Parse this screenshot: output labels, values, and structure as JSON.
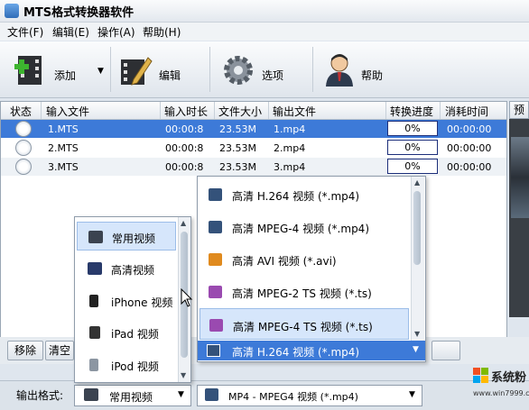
{
  "window": {
    "title": "MTS格式转换器软件"
  },
  "menu": {
    "file": "文件(F)",
    "edit": "编辑(E)",
    "action": "操作(A)",
    "help": "帮助(H)"
  },
  "toolbar": {
    "add": "添加",
    "edit": "编辑",
    "options": "选项",
    "help": "帮助"
  },
  "table": {
    "columns": [
      "状态",
      "输入文件",
      "输入时长",
      "文件大小",
      "输出文件",
      "转换进度",
      "消耗时间"
    ],
    "rows": [
      {
        "input": "1.MTS",
        "duration": "00:00:8",
        "size": "23.53M",
        "output": "1.mp4",
        "progress": "0%",
        "elapsed": "00:00:00"
      },
      {
        "input": "2.MTS",
        "duration": "00:00:8",
        "size": "23.53M",
        "output": "2.mp4",
        "progress": "0%",
        "elapsed": "00:00:00"
      },
      {
        "input": "3.MTS",
        "duration": "00:00:8",
        "size": "23.53M",
        "output": "3.mp4",
        "progress": "0%",
        "elapsed": "00:00:00"
      }
    ]
  },
  "preview": {
    "tab": "预"
  },
  "bottom": {
    "remove": "移除",
    "clear": "清空"
  },
  "category_popup": {
    "items": [
      "常用视频",
      "高清视频",
      "iPhone 视频",
      "iPad 视频",
      "iPod 视频"
    ]
  },
  "format_popup": {
    "items": [
      "高清 H.264 视频 (*.mp4)",
      "高清 MPEG-4 视频 (*.mp4)",
      "高清 AVI 视频 (*.avi)",
      "高清 MPEG-2 TS 视频 (*.ts)",
      "高清 MPEG-4 TS 视频 (*.ts)"
    ],
    "selected": "高清 H.264 视频 (*.mp4)"
  },
  "output": {
    "label": "输出格式:",
    "category": "常用视频",
    "format": "MP4 - MPEG4 视频 (*.mp4)"
  },
  "watermark": {
    "text": "系统粉",
    "url": "www.win7999.com"
  },
  "colors": {
    "selected_row": "#3d7ad8",
    "highlight": "#d6e6fb",
    "progress_border": "#1c2e7a"
  }
}
